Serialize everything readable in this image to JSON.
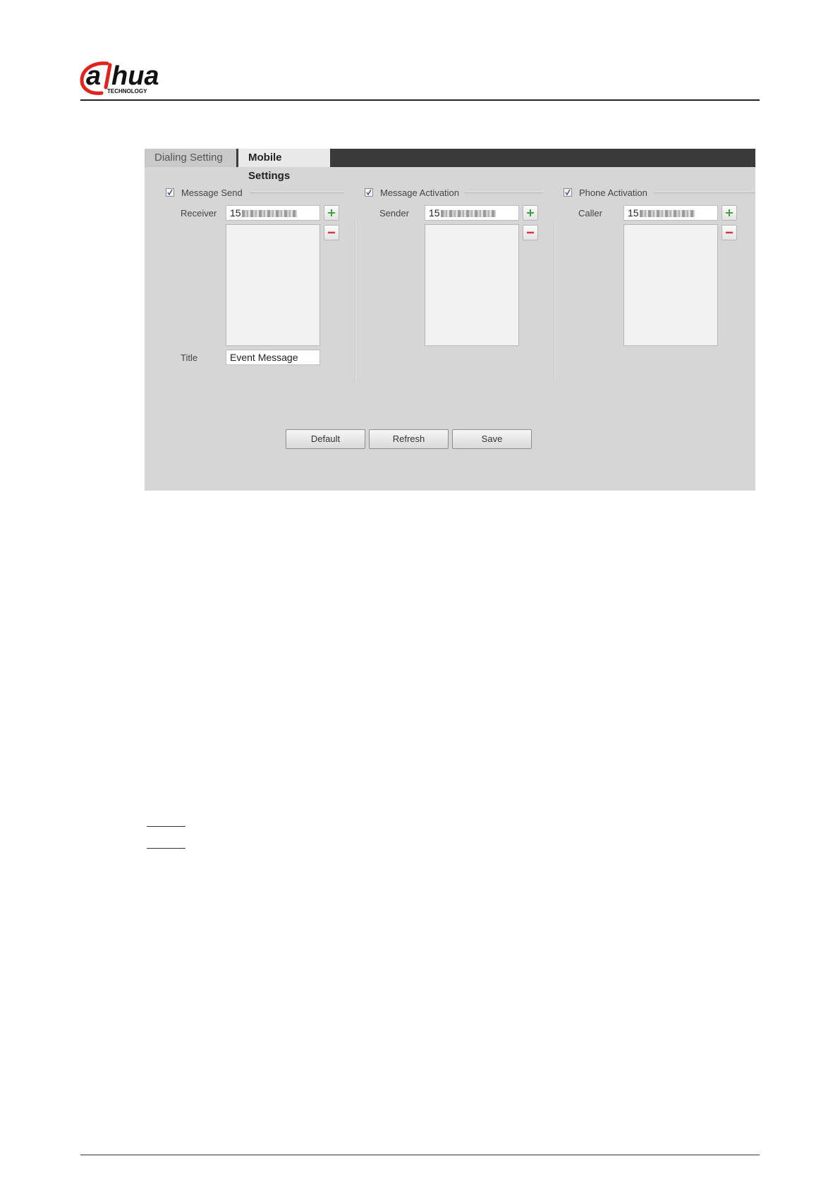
{
  "tabs": [
    {
      "label": "Dialing Setting",
      "active": false
    },
    {
      "label": "Mobile Settings",
      "active": true
    }
  ],
  "sections": {
    "message_send": {
      "checkbox_label": "Message Send",
      "checked": true,
      "receiver_label": "Receiver",
      "receiver_value": "15",
      "title_label": "Title",
      "title_value": "Event Message"
    },
    "message_activation": {
      "checkbox_label": "Message Activation",
      "checked": true,
      "sender_label": "Sender",
      "sender_value": "15"
    },
    "phone_activation": {
      "checkbox_label": "Phone Activation",
      "checked": true,
      "caller_label": "Caller",
      "caller_value": "15"
    }
  },
  "buttons": {
    "default_label": "Default",
    "refresh_label": "Refresh",
    "save_label": "Save"
  },
  "icons": {
    "add": "plus-icon",
    "remove": "minus-icon",
    "check": "checkmark-icon"
  },
  "colors": {
    "add_icon": "#3aa53a",
    "remove_icon": "#d23c3c",
    "brand_red": "#e2231a",
    "tab_bar": "#3a3a3a",
    "panel_bg": "#d6d6d6"
  }
}
